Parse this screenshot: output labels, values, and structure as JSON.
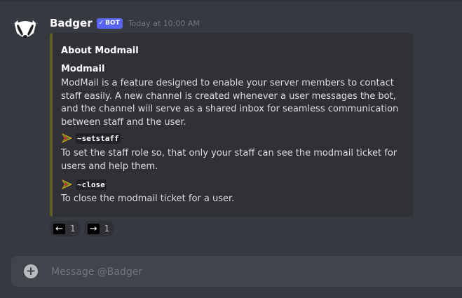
{
  "message": {
    "author": "Badger",
    "bot_tag": "BOT",
    "bot_check": "✓",
    "timestamp": "Today at 10:00 AM",
    "embed": {
      "title": "About Modmail",
      "field_name": "Modmail",
      "description": "ModMail is a feature designed to enable your server members to contact staff easily. A new channel is created whenever a user messages the bot, and the channel will serve as a shared inbox for seamless communication between staff and the user.",
      "commands": [
        {
          "command": "~setstaff",
          "description": "To set the staff role so, that only your staff can see the modmail ticket for users and help them."
        },
        {
          "command": "~close",
          "description": "To close the modmail ticket for a user."
        }
      ],
      "accent_color": "#5e5e1f"
    },
    "reactions": [
      {
        "emoji": "←",
        "count": "1"
      },
      {
        "emoji": "→",
        "count": "1"
      }
    ]
  },
  "composer": {
    "placeholder": "Message @Badger",
    "plus_icon": "+"
  }
}
